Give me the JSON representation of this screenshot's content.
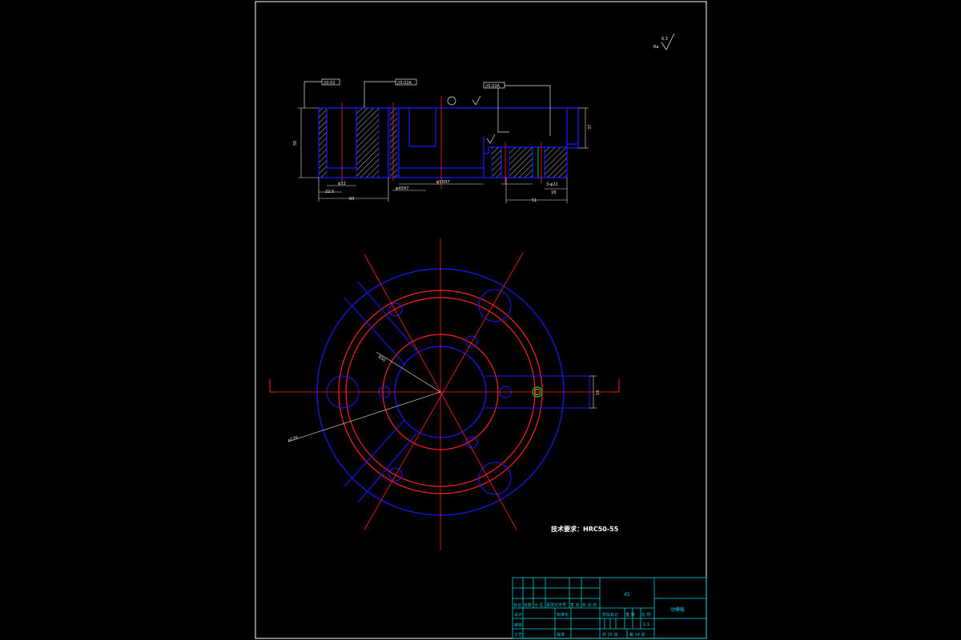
{
  "drawing": {
    "surface_finish": {
      "symbol_value": "6.3",
      "label": "Ra"
    },
    "technical_note": "技术要求：HRC50-55",
    "colors": {
      "background": "#000000",
      "border": "#ffffff",
      "outline": "#1a1aff",
      "centerline": "#ff2020",
      "dimension": "#e8e8e8",
      "hatch": "#e8e8e8",
      "table": "#00cfe0",
      "highlight": "#28c828"
    },
    "section_view": {
      "tolerances": {
        "parallel_left": "//0.02",
        "parallel_mid": "//0.02A",
        "parallel_right": "//0.02A"
      },
      "dimensions": {
        "overall_height": "55",
        "right_height": "37",
        "left_bore": "22.5",
        "hole_diam": "φ32",
        "span": "60",
        "mid_span": "φ55H7",
        "right_span": "18",
        "bottom_span": "51",
        "right_hole": "3-φ22",
        "center_bore": "φ45H7"
      }
    },
    "plan_view": {
      "radius_label": "R50",
      "diameter_label": "φ176",
      "slot_dim": "16"
    },
    "title_block": {
      "part_name": "动模板",
      "material": "45",
      "scale": "1:1",
      "sheet_total": "共 15 张",
      "sheet_no": "第 14 张",
      "row_header": [
        "标记",
        "处数",
        "分 区",
        "更改文件号",
        "签 名",
        "年.月.日"
      ],
      "labels": {
        "design": "设计",
        "standardize": "标准化",
        "stage_mark": "阶段标记",
        "weight": "重 量",
        "scale_label": "比 例",
        "review": "审核",
        "process": "工艺",
        "approve": "批准"
      }
    }
  }
}
